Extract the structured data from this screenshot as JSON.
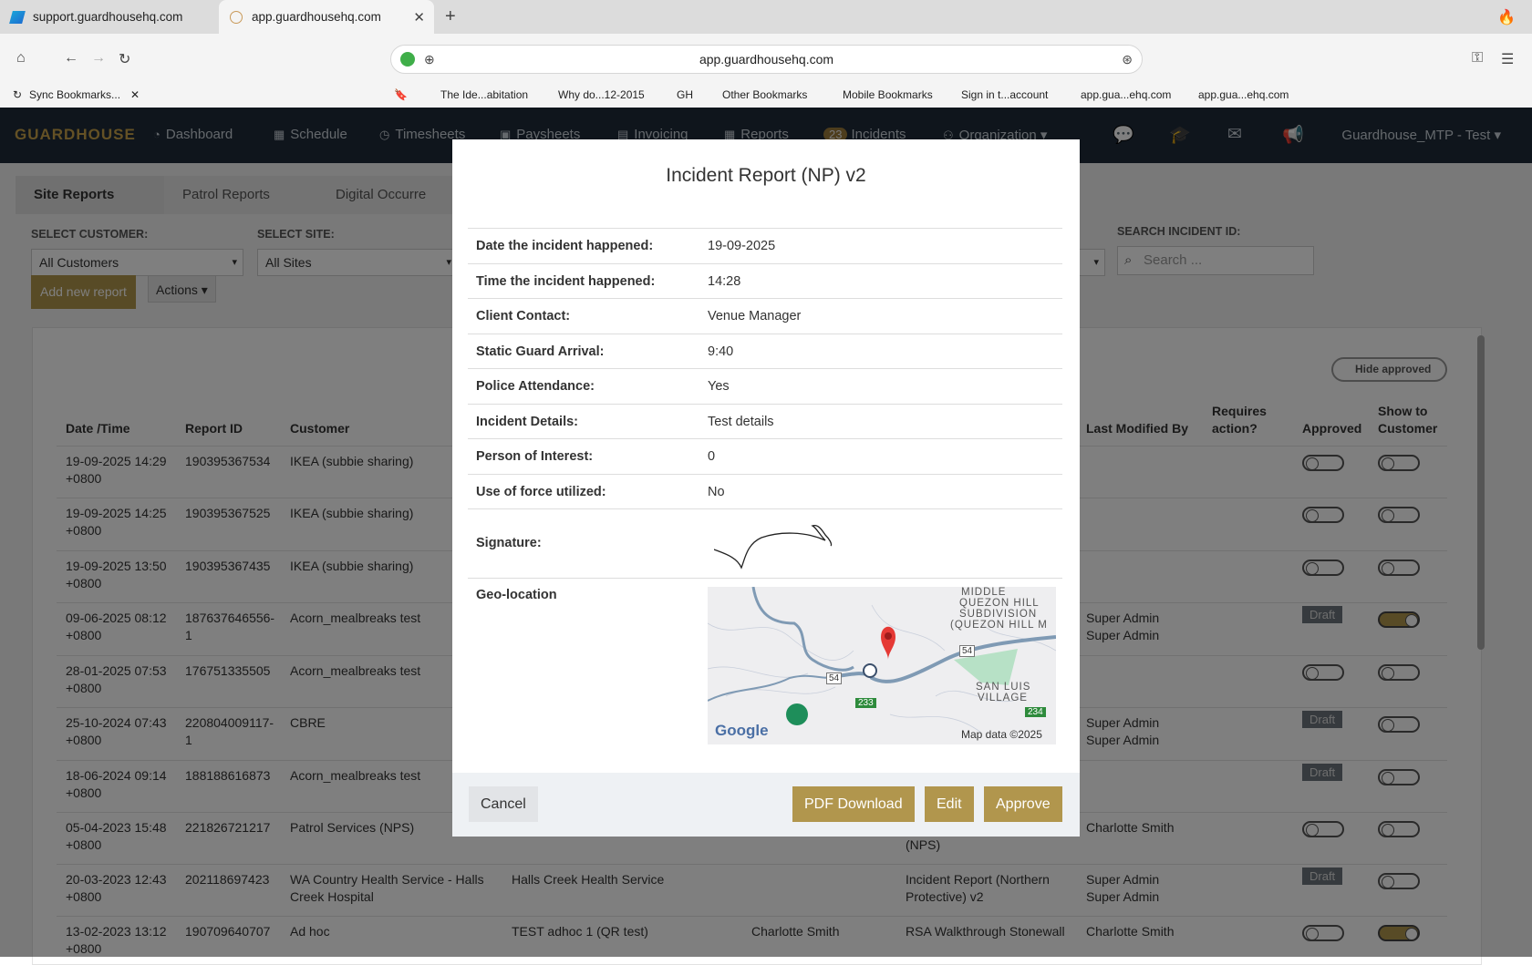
{
  "browser": {
    "tabs": [
      {
        "label": "support.guardhousehq.com"
      },
      {
        "label": "app.guardhousehq.com"
      }
    ],
    "url": "app.guardhousehq.com",
    "bookmarks": [
      "Sync Bookmarks...",
      "The Ide...abitation",
      "Why do...12-2015",
      "GH",
      "Other Bookmarks",
      "Mobile Bookmarks",
      "Sign in t...account",
      "app.gua...ehq.com",
      "app.gua...ehq.com"
    ]
  },
  "app": {
    "logo": "GUARDHOUSE",
    "nav": {
      "dashboard": "Dashboard",
      "schedule": "Schedule",
      "timesheets": "Timesheets",
      "paysheets": "Paysheets",
      "invoicing": "Invoicing",
      "reports": "Reports",
      "incidents_count": "23",
      "incidents": "Incidents",
      "organization": "Organization"
    },
    "user": "Guardhouse_MTP - Test"
  },
  "page": {
    "tabs": [
      "Site Reports",
      "Patrol Reports",
      "Digital Occurre"
    ],
    "select_customer_label": "SELECT CUSTOMER:",
    "select_customer_value": "All Customers",
    "select_site_label": "SELECT SITE:",
    "select_site_value": "All Sites",
    "search_label": "SEARCH INCIDENT ID:",
    "search_placeholder": "Search ...",
    "add_button": "Add new report",
    "actions_button": "Actions",
    "hide_approved": "Hide approved",
    "draft_label": "Draft",
    "columns": {
      "datetime": "Date /Time",
      "report_id": "Report ID",
      "customer": "Customer",
      "last_modified": "Last Modified By",
      "requires1": "Requires",
      "requires2": "action?",
      "approved": "Approved",
      "show1": "Show to",
      "show2": "Customer"
    },
    "rows": [
      {
        "d1": "19-09-2025 14:29",
        "d2": "+0800",
        "id1": "190395367534",
        "id2": "",
        "c1": "IKEA (subbie sharing)",
        "c2": "",
        "site": "",
        "officer": "",
        "type1": "",
        "type2": "",
        "m1": "",
        "m2": "",
        "draft": false,
        "show_on": false
      },
      {
        "d1": "19-09-2025 14:25",
        "d2": "+0800",
        "id1": "190395367525",
        "id2": "",
        "c1": "IKEA (subbie sharing)",
        "c2": "",
        "site": "",
        "officer": "",
        "type1": "",
        "type2": "",
        "m1": "",
        "m2": "",
        "draft": false,
        "show_on": false
      },
      {
        "d1": "19-09-2025 13:50",
        "d2": "+0800",
        "id1": "190395367435",
        "id2": "",
        "c1": "IKEA (subbie sharing)",
        "c2": "",
        "site": "",
        "officer": "",
        "type1": "",
        "type2": "",
        "m1": "",
        "m2": "",
        "draft": false,
        "show_on": false
      },
      {
        "d1": "09-06-2025 08:12",
        "d2": "+0800",
        "id1": "187637646556-",
        "id2": "1",
        "c1": "Acorn_mealbreaks test",
        "c2": "",
        "site": "",
        "officer": "",
        "type1": "",
        "type2": "",
        "m1": "Super Admin",
        "m2": "Super Admin",
        "draft": true,
        "show_on": true
      },
      {
        "d1": "28-01-2025 07:53",
        "d2": "+0800",
        "id1": "176751335505",
        "id2": "",
        "c1": "Acorn_mealbreaks test",
        "c2": "",
        "site": "",
        "officer": "",
        "type1": "",
        "type2": "",
        "m1": "",
        "m2": "",
        "draft": false,
        "show_on": false
      },
      {
        "d1": "25-10-2024 07:43",
        "d2": "+0800",
        "id1": "220804009117-",
        "id2": "1",
        "c1": "CBRE",
        "c2": "",
        "site": "",
        "officer": "",
        "type1": "",
        "type2": "",
        "m1": "Super Admin",
        "m2": "Super Admin",
        "draft": true,
        "show_on": false
      },
      {
        "d1": "18-06-2024 09:14",
        "d2": "+0800",
        "id1": "188188616873",
        "id2": "",
        "c1": "Acorn_mealbreaks test",
        "c2": "",
        "site": "",
        "officer": "",
        "type1": "",
        "type2": "",
        "m1": "",
        "m2": "",
        "draft": true,
        "show_on": false
      },
      {
        "d1": "05-04-2023 15:48",
        "d2": "+0800",
        "id1": "221826721217",
        "id2": "",
        "c1": "Patrol Services (NPS)",
        "c2": "",
        "site": "",
        "officer": "",
        "type1": "",
        "type2": "(NPS)",
        "m1": "Charlotte Smith",
        "m2": "",
        "draft": false,
        "show_on": false
      },
      {
        "d1": "20-03-2023 12:43",
        "d2": "+0800",
        "id1": "202118697423",
        "id2": "",
        "c1": "WA Country Health Service - Halls",
        "c2": "Creek Hospital",
        "site": "Halls Creek Health Service",
        "officer": "",
        "type1": "Incident Report (Northern",
        "type2": "Protective) v2",
        "m1": "Super Admin",
        "m2": "Super Admin",
        "draft": true,
        "show_on": false
      },
      {
        "d1": "13-02-2023 13:12",
        "d2": "+0800",
        "id1": "190709640707",
        "id2": "",
        "c1": "Ad hoc",
        "c2": "",
        "site": "TEST adhoc 1 (QR test)",
        "officer": "Charlotte Smith",
        "type1": "RSA Walkthrough Stonewall",
        "type2": "",
        "m1": "Charlotte Smith",
        "m2": "",
        "draft": false,
        "show_on": true
      }
    ]
  },
  "modal": {
    "title": "Incident Report (NP) v2",
    "fields": [
      {
        "label": "Date the incident happened:",
        "value": "19-09-2025"
      },
      {
        "label": "Time the incident happened:",
        "value": "14:28"
      },
      {
        "label": "Client Contact:",
        "value": "Venue Manager"
      },
      {
        "label": "Static Guard Arrival:",
        "value": "9:40"
      },
      {
        "label": "Police Attendance:",
        "value": "Yes"
      },
      {
        "label": "Incident Details:",
        "value": "Test details"
      },
      {
        "label": "Person of Interest:",
        "value": "0"
      },
      {
        "label": "Use of force utilized:",
        "value": "No"
      }
    ],
    "signature_label": "Signature:",
    "geo_label": "Geo-location",
    "map": {
      "place1": "MIDDLE",
      "place2": "QUEZON HILL",
      "place3": "SUBDIVISION",
      "place4": "(QUEZON HILL M",
      "place5": "SAN LUIS",
      "place6": "VILLAGE",
      "route_a": "54",
      "route_b": "54",
      "route_c": "233",
      "route_d": "234",
      "google": "Google",
      "attribution": "Map data ©2025"
    },
    "buttons": {
      "cancel": "Cancel",
      "pdf": "PDF Download",
      "edit": "Edit",
      "approve": "Approve"
    }
  }
}
